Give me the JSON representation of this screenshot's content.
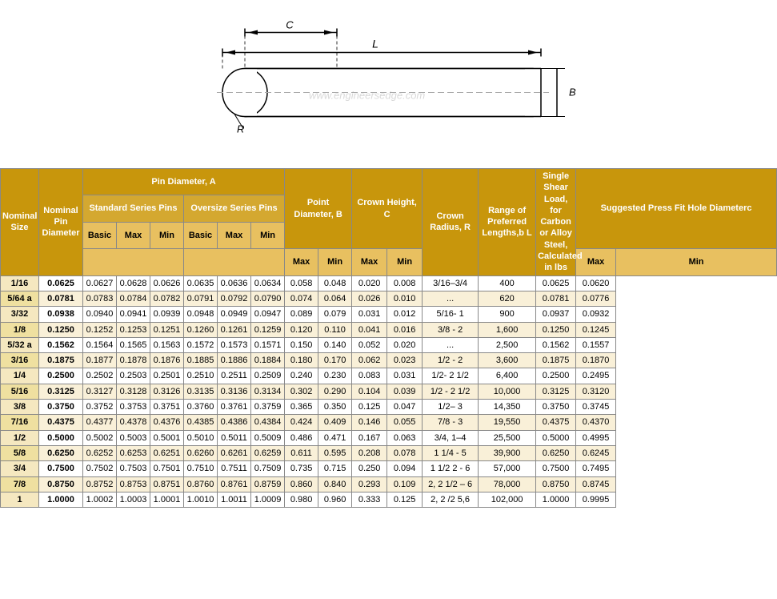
{
  "diagram": {
    "watermark": "www.engineersedge.com"
  },
  "table": {
    "headers": {
      "col1": "Nominal Size",
      "col2": "Nominal Pin Diameter",
      "pin_diameter": "Pin Diameter, A",
      "standard_series": "Standard Series Pins",
      "oversize_series": "Oversize Series Pins",
      "point_diam": "Point Diameter, B",
      "crown_height": "Crown Height, C",
      "crown_radius": "Crown Radius, R",
      "range": "Range of Preferred Lengths,b L",
      "shear": "Single Shear Load, for Carbon or Alloy Steel, Calculated in lbs",
      "press_fit": "Suggested Press Fit Hole Diameterc",
      "basic": "Basic",
      "max": "Max",
      "min": "Min",
      "max2": "Max",
      "min2": "Min"
    },
    "rows": [
      {
        "nominal_size": "1/16",
        "nom_pin": "0.0625",
        "std_basic": "0.0627",
        "std_max": "0.0628",
        "std_min": "0.0626",
        "over_basic": "0.0635",
        "over_max": "0.0636",
        "over_min": "0.0634",
        "pt_max": "0.058",
        "pt_min": "0.048",
        "crown_max": "0.020",
        "crown_min": "0.008",
        "range": "3/16–3/4",
        "shear": "400",
        "press_max": "0.0625",
        "press_min": "0.0620"
      },
      {
        "nominal_size": "5/64 a",
        "nom_pin": "0.0781",
        "std_basic": "0.0783",
        "std_max": "0.0784",
        "std_min": "0.0782",
        "over_basic": "0.0791",
        "over_max": "0.0792",
        "over_min": "0.0790",
        "pt_max": "0.074",
        "pt_min": "0.064",
        "crown_max": "0.026",
        "crown_min": "0.010",
        "range": "...",
        "shear": "620",
        "press_max": "0.0781",
        "press_min": "0.0776"
      },
      {
        "nominal_size": "3/32",
        "nom_pin": "0.0938",
        "std_basic": "0.0940",
        "std_max": "0.0941",
        "std_min": "0.0939",
        "over_basic": "0.0948",
        "over_max": "0.0949",
        "over_min": "0.0947",
        "pt_max": "0.089",
        "pt_min": "0.079",
        "crown_max": "0.031",
        "crown_min": "0.012",
        "range": "5/16- 1",
        "shear": "900",
        "press_max": "0.0937",
        "press_min": "0.0932"
      },
      {
        "nominal_size": "1/8",
        "nom_pin": "0.1250",
        "std_basic": "0.1252",
        "std_max": "0.1253",
        "std_min": "0.1251",
        "over_basic": "0.1260",
        "over_max": "0.1261",
        "over_min": "0.1259",
        "pt_max": "0.120",
        "pt_min": "0.110",
        "crown_max": "0.041",
        "crown_min": "0.016",
        "range": "3/8 - 2",
        "shear": "1,600",
        "press_max": "0.1250",
        "press_min": "0.1245"
      },
      {
        "nominal_size": "5/32 a",
        "nom_pin": "0.1562",
        "std_basic": "0.1564",
        "std_max": "0.1565",
        "std_min": "0.1563",
        "over_basic": "0.1572",
        "over_max": "0.1573",
        "over_min": "0.1571",
        "pt_max": "0.150",
        "pt_min": "0.140",
        "crown_max": "0.052",
        "crown_min": "0.020",
        "range": "...",
        "shear": "2,500",
        "press_max": "0.1562",
        "press_min": "0.1557"
      },
      {
        "nominal_size": "3/16",
        "nom_pin": "0.1875",
        "std_basic": "0.1877",
        "std_max": "0.1878",
        "std_min": "0.1876",
        "over_basic": "0.1885",
        "over_max": "0.1886",
        "over_min": "0.1884",
        "pt_max": "0.180",
        "pt_min": "0.170",
        "crown_max": "0.062",
        "crown_min": "0.023",
        "range": "1/2 - 2",
        "shear": "3,600",
        "press_max": "0.1875",
        "press_min": "0.1870"
      },
      {
        "nominal_size": "1/4",
        "nom_pin": "0.2500",
        "std_basic": "0.2502",
        "std_max": "0.2503",
        "std_min": "0.2501",
        "over_basic": "0.2510",
        "over_max": "0.2511",
        "over_min": "0.2509",
        "pt_max": "0.240",
        "pt_min": "0.230",
        "crown_max": "0.083",
        "crown_min": "0.031",
        "range": "1/2- 2 1/2",
        "shear": "6,400",
        "press_max": "0.2500",
        "press_min": "0.2495"
      },
      {
        "nominal_size": "5/16",
        "nom_pin": "0.3125",
        "std_basic": "0.3127",
        "std_max": "0.3128",
        "std_min": "0.3126",
        "over_basic": "0.3135",
        "over_max": "0.3136",
        "over_min": "0.3134",
        "pt_max": "0.302",
        "pt_min": "0.290",
        "crown_max": "0.104",
        "crown_min": "0.039",
        "range": "1/2 - 2 1/2",
        "shear": "10,000",
        "press_max": "0.3125",
        "press_min": "0.3120"
      },
      {
        "nominal_size": "3/8",
        "nom_pin": "0.3750",
        "std_basic": "0.3752",
        "std_max": "0.3753",
        "std_min": "0.3751",
        "over_basic": "0.3760",
        "over_max": "0.3761",
        "over_min": "0.3759",
        "pt_max": "0.365",
        "pt_min": "0.350",
        "crown_max": "0.125",
        "crown_min": "0.047",
        "range": "1/2– 3",
        "shear": "14,350",
        "press_max": "0.3750",
        "press_min": "0.3745"
      },
      {
        "nominal_size": "7/16",
        "nom_pin": "0.4375",
        "std_basic": "0.4377",
        "std_max": "0.4378",
        "std_min": "0.4376",
        "over_basic": "0.4385",
        "over_max": "0.4386",
        "over_min": "0.4384",
        "pt_max": "0.424",
        "pt_min": "0.409",
        "crown_max": "0.146",
        "crown_min": "0.055",
        "range": "7/8 - 3",
        "shear": "19,550",
        "press_max": "0.4375",
        "press_min": "0.4370"
      },
      {
        "nominal_size": "1/2",
        "nom_pin": "0.5000",
        "std_basic": "0.5002",
        "std_max": "0.5003",
        "std_min": "0.5001",
        "over_basic": "0.5010",
        "over_max": "0.5011",
        "over_min": "0.5009",
        "pt_max": "0.486",
        "pt_min": "0.471",
        "crown_max": "0.167",
        "crown_min": "0.063",
        "range": "3/4, 1–4",
        "shear": "25,500",
        "press_max": "0.5000",
        "press_min": "0.4995"
      },
      {
        "nominal_size": "5/8",
        "nom_pin": "0.6250",
        "std_basic": "0.6252",
        "std_max": "0.6253",
        "std_min": "0.6251",
        "over_basic": "0.6260",
        "over_max": "0.6261",
        "over_min": "0.6259",
        "pt_max": "0.611",
        "pt_min": "0.595",
        "crown_max": "0.208",
        "crown_min": "0.078",
        "range": "1 1/4 - 5",
        "shear": "39,900",
        "press_max": "0.6250",
        "press_min": "0.6245"
      },
      {
        "nominal_size": "3/4",
        "nom_pin": "0.7500",
        "std_basic": "0.7502",
        "std_max": "0.7503",
        "std_min": "0.7501",
        "over_basic": "0.7510",
        "over_max": "0.7511",
        "over_min": "0.7509",
        "pt_max": "0.735",
        "pt_min": "0.715",
        "crown_max": "0.250",
        "crown_min": "0.094",
        "range": "1 1/2 2 - 6",
        "shear": "57,000",
        "press_max": "0.7500",
        "press_min": "0.7495"
      },
      {
        "nominal_size": "7/8",
        "nom_pin": "0.8750",
        "std_basic": "0.8752",
        "std_max": "0.8753",
        "std_min": "0.8751",
        "over_basic": "0.8760",
        "over_max": "0.8761",
        "over_min": "0.8759",
        "pt_max": "0.860",
        "pt_min": "0.840",
        "crown_max": "0.293",
        "crown_min": "0.109",
        "range": "2, 2 1/2 – 6",
        "shear": "78,000",
        "press_max": "0.8750",
        "press_min": "0.8745"
      },
      {
        "nominal_size": "1",
        "nom_pin": "1.0000",
        "std_basic": "1.0002",
        "std_max": "1.0003",
        "std_min": "1.0001",
        "over_basic": "1.0010",
        "over_max": "1.0011",
        "over_min": "1.0009",
        "pt_max": "0.980",
        "pt_min": "0.960",
        "crown_max": "0.333",
        "crown_min": "0.125",
        "range": "2, 2 /2 5,6",
        "shear": "102,000",
        "press_max": "1.0000",
        "press_min": "0.9995"
      }
    ]
  }
}
